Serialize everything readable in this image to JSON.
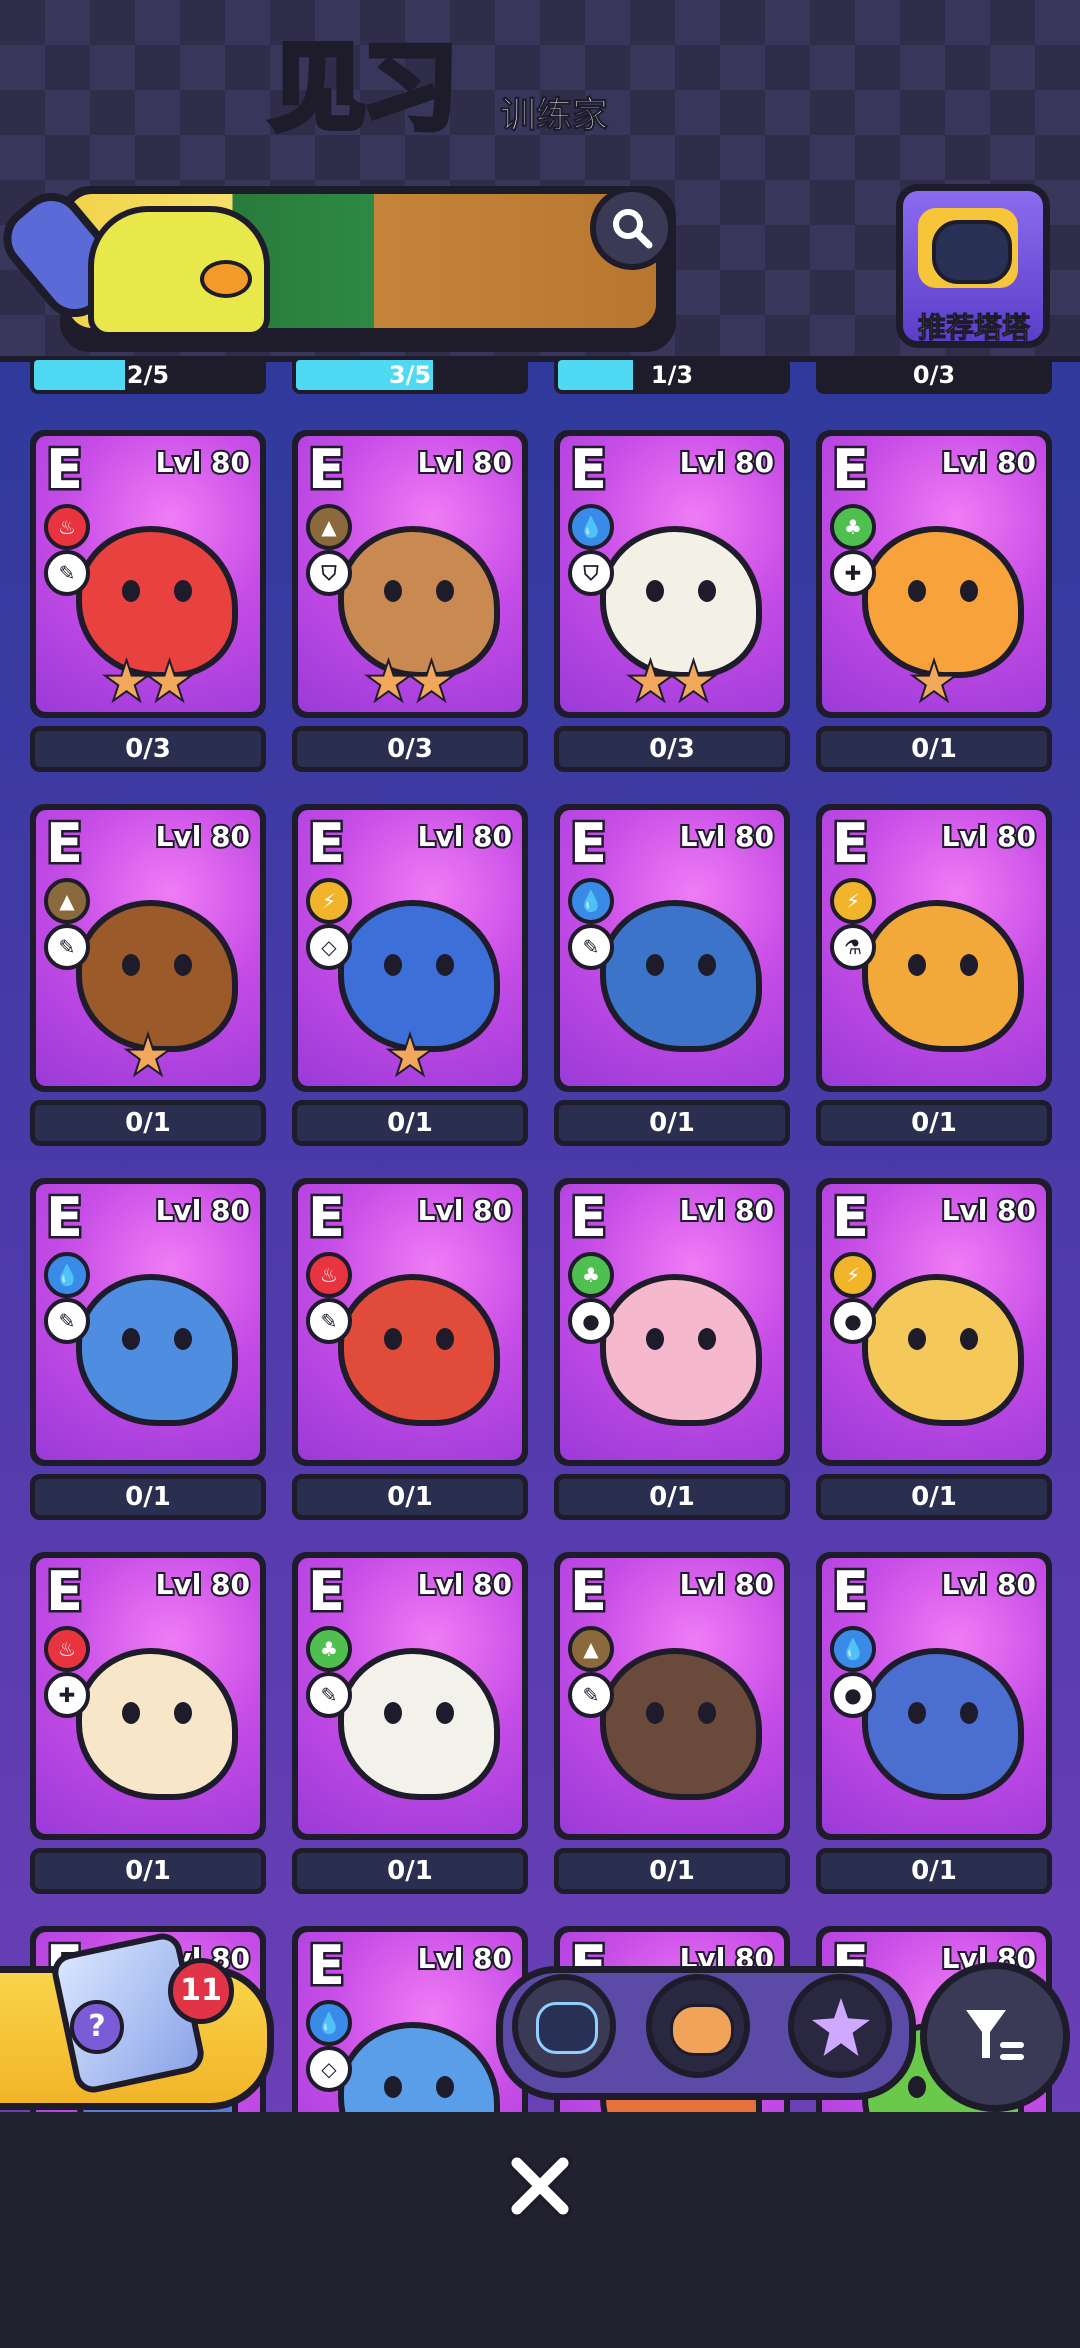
{
  "header": {
    "title": "见习",
    "subtitle": "训练家",
    "recommend_label": "推荐塔塔"
  },
  "top_progress": [
    {
      "text": "2/5",
      "fraction": 0.4
    },
    {
      "text": "3/5",
      "fraction": 0.6
    },
    {
      "text": "1/3",
      "fraction": 0.33
    },
    {
      "text": "0/3",
      "fraction": 0
    }
  ],
  "cards": [
    {
      "grade": "E",
      "level": "Lvl 80",
      "element": "fire",
      "element_color": "#e8343f",
      "role": "pin-icon",
      "stars": "★★",
      "count": "0/3",
      "body": "#e8413f"
    },
    {
      "grade": "E",
      "level": "Lvl 80",
      "element": "earth",
      "element_color": "#8a6a3c",
      "role": "shield-icon",
      "stars": "★★",
      "count": "0/3",
      "body": "#c98a52"
    },
    {
      "grade": "E",
      "level": "Lvl 80",
      "element": "water",
      "element_color": "#3a8ae8",
      "role": "shield-icon",
      "stars": "★★",
      "count": "0/3",
      "body": "#f3f1e6"
    },
    {
      "grade": "E",
      "level": "Lvl 80",
      "element": "grass",
      "element_color": "#4fbf4f",
      "role": "plus-icon",
      "stars": "★",
      "count": "0/1",
      "body": "#f7a23a"
    },
    {
      "grade": "E",
      "level": "Lvl 80",
      "element": "earth",
      "element_color": "#8a6a3c",
      "role": "pin-icon",
      "stars": "★",
      "count": "0/1",
      "body": "#9a5a2a"
    },
    {
      "grade": "E",
      "level": "Lvl 80",
      "element": "electric",
      "element_color": "#f0b52a",
      "role": "diamond-icon",
      "stars": "★",
      "count": "0/1",
      "body": "#3d6fd8"
    },
    {
      "grade": "E",
      "level": "Lvl 80",
      "element": "water",
      "element_color": "#3a8ae8",
      "role": "pin-icon",
      "stars": "",
      "count": "0/1",
      "body": "#3b74c8"
    },
    {
      "grade": "E",
      "level": "Lvl 80",
      "element": "electric",
      "element_color": "#f0b52a",
      "role": "flask-icon",
      "stars": "",
      "count": "0/1",
      "body": "#f2a93a"
    },
    {
      "grade": "E",
      "level": "Lvl 80",
      "element": "water",
      "element_color": "#3a8ae8",
      "role": "pin-icon",
      "stars": "",
      "count": "0/1",
      "body": "#4f8de0"
    },
    {
      "grade": "E",
      "level": "Lvl 80",
      "element": "fire",
      "element_color": "#e8343f",
      "role": "pin-icon",
      "stars": "",
      "count": "0/1",
      "body": "#e04b3a"
    },
    {
      "grade": "E",
      "level": "Lvl 80",
      "element": "grass",
      "element_color": "#4fbf4f",
      "role": "drop-icon",
      "stars": "",
      "count": "0/1",
      "body": "#f6b8cc"
    },
    {
      "grade": "E",
      "level": "Lvl 80",
      "element": "electric",
      "element_color": "#f0b52a",
      "role": "drop-icon",
      "stars": "",
      "count": "0/1",
      "body": "#f5c85a"
    },
    {
      "grade": "E",
      "level": "Lvl 80",
      "element": "fire",
      "element_color": "#e8343f",
      "role": "plus-icon",
      "stars": "",
      "count": "0/1",
      "body": "#f7e6c8"
    },
    {
      "grade": "E",
      "level": "Lvl 80",
      "element": "grass",
      "element_color": "#4fbf4f",
      "role": "pin-icon",
      "stars": "",
      "count": "0/1",
      "body": "#f2f2ea"
    },
    {
      "grade": "E",
      "level": "Lvl 80",
      "element": "earth",
      "element_color": "#8a6a3c",
      "role": "pin-icon",
      "stars": "",
      "count": "0/1",
      "body": "#6a4a3a"
    },
    {
      "grade": "E",
      "level": "Lvl 80",
      "element": "water",
      "element_color": "#3a8ae8",
      "role": "drop-icon",
      "stars": "",
      "count": "0/1",
      "body": "#4a6fd0"
    },
    {
      "grade": "E",
      "level": "Lvl 80",
      "element": "",
      "element_color": "#e8343f",
      "role": "",
      "stars": "",
      "count": "",
      "body": "#5a7ad8"
    },
    {
      "grade": "E",
      "level": "Lvl 80",
      "element": "water",
      "element_color": "#3a8ae8",
      "role": "diamond-icon",
      "stars": "",
      "count": "",
      "body": "#5a9de8"
    },
    {
      "grade": "E",
      "level": "Lvl 80",
      "element": "",
      "element_color": "#e8343f",
      "role": "",
      "stars": "",
      "count": "",
      "body": "#e8703a"
    },
    {
      "grade": "E",
      "level": "Lvl 80",
      "element": "",
      "element_color": "#4fbf4f",
      "role": "",
      "stars": "",
      "count": "",
      "body": "#6ac84a"
    }
  ],
  "gacha_badge": "11",
  "bottom_tabs": [
    "cat-robot-icon",
    "hamster-icon",
    "star-cat-icon"
  ],
  "filter_icon": "filter-icon",
  "close_icon": "close-icon"
}
